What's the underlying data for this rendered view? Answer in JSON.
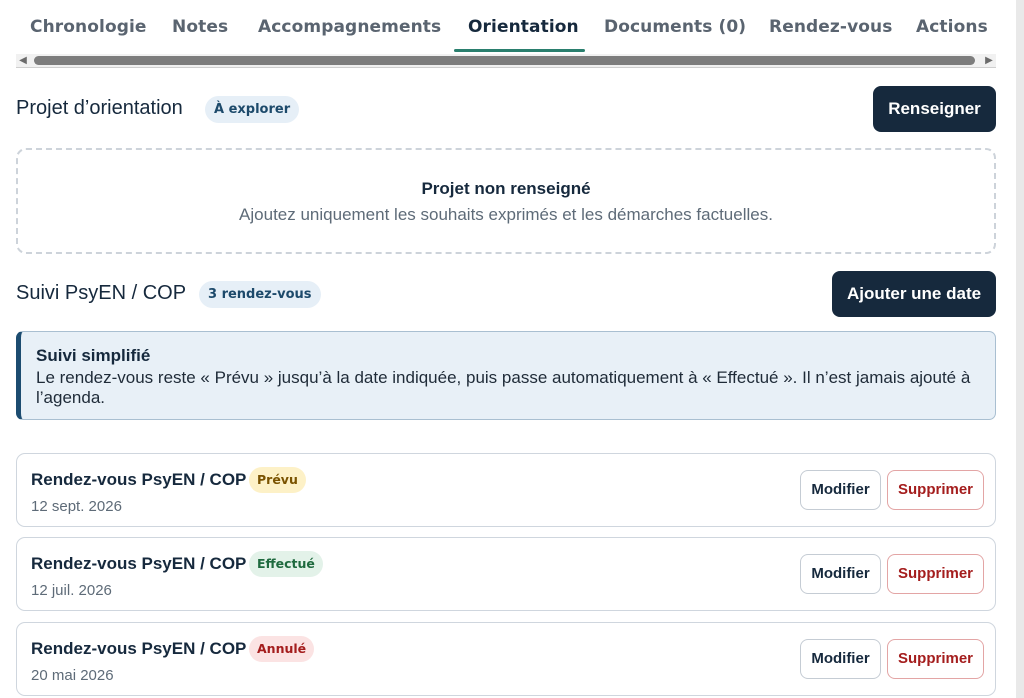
{
  "tabs": [
    {
      "label": "Chronologie",
      "active": false
    },
    {
      "label": "Notes",
      "active": false
    },
    {
      "label": "Accompagnements",
      "active": false
    },
    {
      "label": "Orientation",
      "active": true
    },
    {
      "label": "Documents (0)",
      "active": false
    },
    {
      "label": "Rendez-vous",
      "active": false
    },
    {
      "label": "Actions",
      "active": false
    }
  ],
  "project": {
    "title": "Projet d’orientation",
    "badge": "À explorer",
    "button_label": "Renseigner",
    "empty_title": "Projet non renseigné",
    "empty_text": "Ajoutez uniquement les souhaits exprimés et les démarches factuelles."
  },
  "followup": {
    "title": "Suivi PsyEN / COP",
    "badge": "3 rendez-vous",
    "button_label": "Ajouter une date",
    "info_title": "Suivi simplifié",
    "info_text": "Le rendez-vous reste « Prévu » jusqu’à la date indiquée, puis passe automatiquement à « Effectué ». Il n’est jamais ajouté à l’agenda."
  },
  "appointments": [
    {
      "title": "Rendez-vous PsyEN / COP",
      "status": "Prévu",
      "status_bg": "#fdf1c7",
      "status_color": "#7a5300",
      "date": "12 sept. 2026",
      "edit_label": "Modifier",
      "delete_label": "Supprimer"
    },
    {
      "title": "Rendez-vous PsyEN / COP",
      "status": "Effectué",
      "status_bg": "#e3f2e9",
      "status_color": "#1f6a3f",
      "date": "12 juil. 2026",
      "edit_label": "Modifier",
      "delete_label": "Supprimer"
    },
    {
      "title": "Rendez-vous PsyEN / COP",
      "status": "Annulé",
      "status_bg": "#fbe3e3",
      "status_color": "#a41d1d",
      "date": "20 mai 2026",
      "edit_label": "Modifier",
      "delete_label": "Supprimer"
    }
  ],
  "colors": {
    "accent": "#16293d",
    "tab_underline": "#2a7f6e",
    "danger": "#a41d1d"
  }
}
